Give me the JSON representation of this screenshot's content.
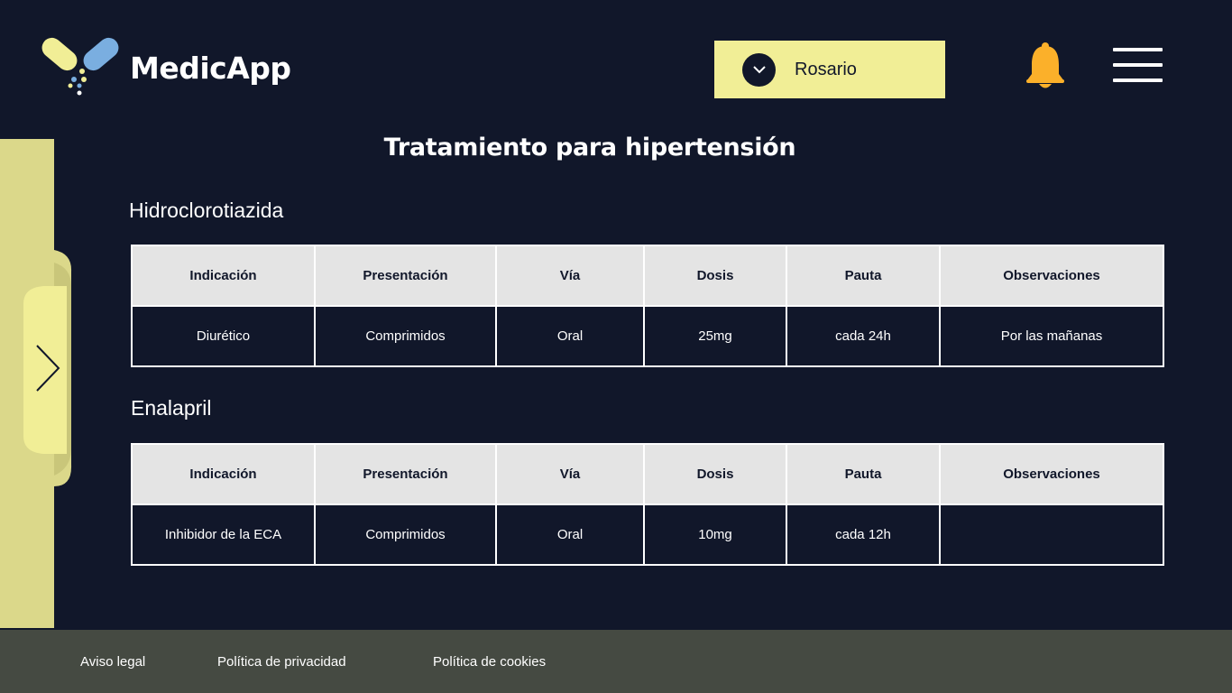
{
  "header": {
    "app_name": "MedicApp",
    "user": {
      "selected": "Rosario"
    }
  },
  "side_panel": {
    "toggle_icon": "chevron-right-icon"
  },
  "main": {
    "title": "Tratamiento para hipertensión",
    "medications": [
      {
        "name": "Hidroclorotiazida",
        "columns": [
          "Indicación",
          "Presentación",
          "Vía",
          "Dosis",
          "Pauta",
          "Observaciones"
        ],
        "row": [
          "Diurético",
          "Comprimidos",
          "Oral",
          "25mg",
          "cada 24h",
          "Por las mañanas"
        ]
      },
      {
        "name": "Enalapril",
        "columns": [
          "Indicación",
          "Presentación",
          "Vía",
          "Dosis",
          "Pauta",
          "Observaciones"
        ],
        "row": [
          "Inhibidor de la ECA",
          "Comprimidos",
          "Oral",
          "10mg",
          "cada 12h",
          ""
        ]
      }
    ]
  },
  "footer": {
    "links": [
      "Aviso legal",
      "Política de privacidad",
      "Política de cookies"
    ]
  },
  "colors": {
    "background": "#11172a",
    "accent_yellow": "#f1ee96",
    "side_panel": "#dbd88a",
    "bell": "#fbb02a",
    "footer": "#454a42",
    "table_header": "#e4e4e4"
  }
}
